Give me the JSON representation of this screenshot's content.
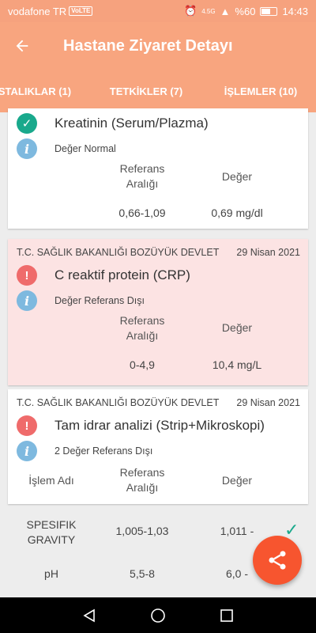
{
  "status_bar": {
    "carrier": "vodafone TR",
    "volte": "VoLTE",
    "signal": "4.5G",
    "battery": "%60",
    "time": "14:43"
  },
  "header": {
    "title": "Hastane Ziyaret Detayı",
    "back_icon": "arrow-left-icon"
  },
  "tabs": [
    {
      "label": "STALIKLAR (1)"
    },
    {
      "label": "TETKİKLER (7)",
      "active": true
    },
    {
      "label": "İŞLEMLER (10)"
    }
  ],
  "cards": [
    {
      "institution": "",
      "date": "",
      "status": "ok",
      "test_name": "Kreatinin (Serum/Plazma)",
      "info": "Değer Normal",
      "ref_header": "Referans Aralığı",
      "value_header": "Değer",
      "ref_value": "0,66-1,09",
      "value": "0,69 mg/dl"
    },
    {
      "institution": "T.C. SAĞLIK BAKANLIĞI BOZÜYÜK DEVLET",
      "date": "29 Nisan 2021",
      "status": "warn",
      "test_name": "C reaktif protein (CRP)",
      "info": "Değer Referans Dışı",
      "ref_header": "Referans Aralığı",
      "value_header": "Değer",
      "ref_value": "0-4,9",
      "value": "10,4 mg/L"
    },
    {
      "institution": "T.C. SAĞLIK BAKANLIĞI BOZÜYÜK DEVLET",
      "date": "29 Nisan 2021",
      "status": "warn",
      "test_name": "Tam idrar analizi (Strip+Mikroskopi)",
      "info": "2 Değer Referans Dışı",
      "name_header": "İşlem Adı",
      "ref_header": "Referans Aralığı",
      "value_header": "Değer"
    }
  ],
  "sub_rows": [
    {
      "name": "SPESIFIK GRAVITY",
      "ref": "1,005-1,03",
      "value": "1,011 -",
      "ok": true
    },
    {
      "name": "pH",
      "ref": "5,5-8",
      "value": "6,0 -"
    }
  ],
  "colors": {
    "header_bg": "#f8a57f",
    "tab_indicator": "#2a9fd6",
    "ok_green": "#19a98c",
    "warn_red": "#ef6b6b",
    "info_blue": "#7eb9df",
    "alert_card_bg": "#fce3e3",
    "fab": "#f7552f"
  },
  "fab": {
    "icon": "share-icon"
  },
  "nav": {
    "back": "nav-back-icon",
    "home": "nav-home-icon",
    "recents": "nav-recents-icon"
  }
}
